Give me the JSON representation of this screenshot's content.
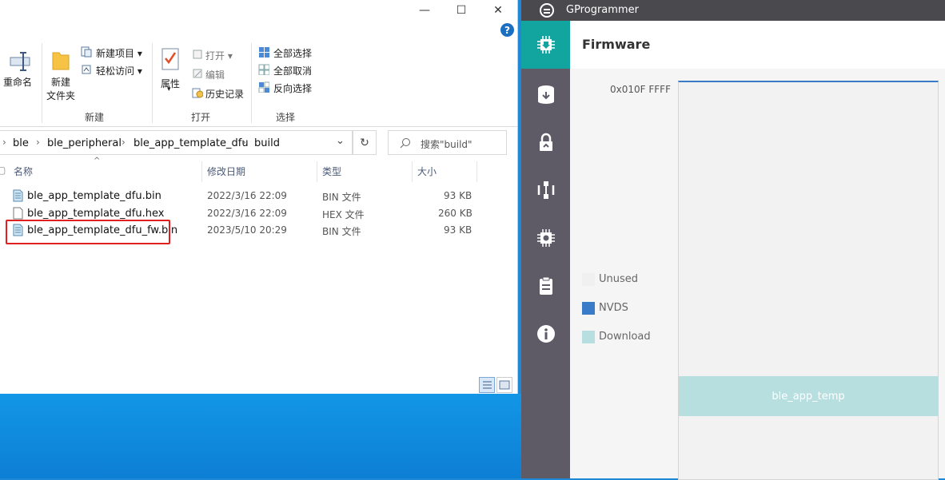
{
  "explorer": {
    "ribbon": {
      "rename": "重命名",
      "new_folder_line1": "新建",
      "new_folder_line2": "文件夹",
      "new_item": "新建项目 ▾",
      "easy_access": "轻松访问 ▾",
      "group_new": "新建",
      "properties": "属性",
      "open": "打开 ▾",
      "edit": "编辑",
      "history": "历史记录",
      "group_open": "打开",
      "select_all": "全部选择",
      "select_none": "全部取消",
      "invert_selection": "反向选择",
      "group_select": "选择"
    },
    "breadcrumb": [
      "ble",
      "ble_peripheral",
      "ble_app_template_dfu",
      "build"
    ],
    "search_placeholder": "搜索\"build\"",
    "columns": {
      "name": "名称",
      "date": "修改日期",
      "type": "类型",
      "size": "大小"
    },
    "files": [
      {
        "name": "ble_app_template_dfu.bin",
        "date": "2022/3/16 22:09",
        "type": "BIN 文件",
        "size": "93 KB",
        "icon": "bin-file-icon"
      },
      {
        "name": "ble_app_template_dfu.hex",
        "date": "2022/3/16 22:09",
        "type": "HEX 文件",
        "size": "260 KB",
        "icon": "file-icon"
      },
      {
        "name": "ble_app_template_dfu_fw.bin",
        "date": "2023/5/10 20:29",
        "type": "BIN 文件",
        "size": "93 KB",
        "icon": "bin-file-icon"
      }
    ],
    "highlight_color": "#e02020"
  },
  "gprogrammer": {
    "app_title": "GProgrammer",
    "page_title": "Firmware",
    "address_top": "0x010F FFFF",
    "legend": [
      {
        "label": "Unused",
        "color": "#f0f0f0"
      },
      {
        "label": "NVDS",
        "color": "#3a7bc8"
      },
      {
        "label": "Download",
        "color": "#b7dfe0"
      }
    ],
    "download_block_label": "ble_app_temp",
    "accent_color": "#12a5a0",
    "sidebar_icons": [
      "firmware-chip-icon",
      "storage-download-icon",
      "lock-icon",
      "connection-icon",
      "chip-settings-icon",
      "clipboard-icon",
      "info-icon"
    ]
  }
}
